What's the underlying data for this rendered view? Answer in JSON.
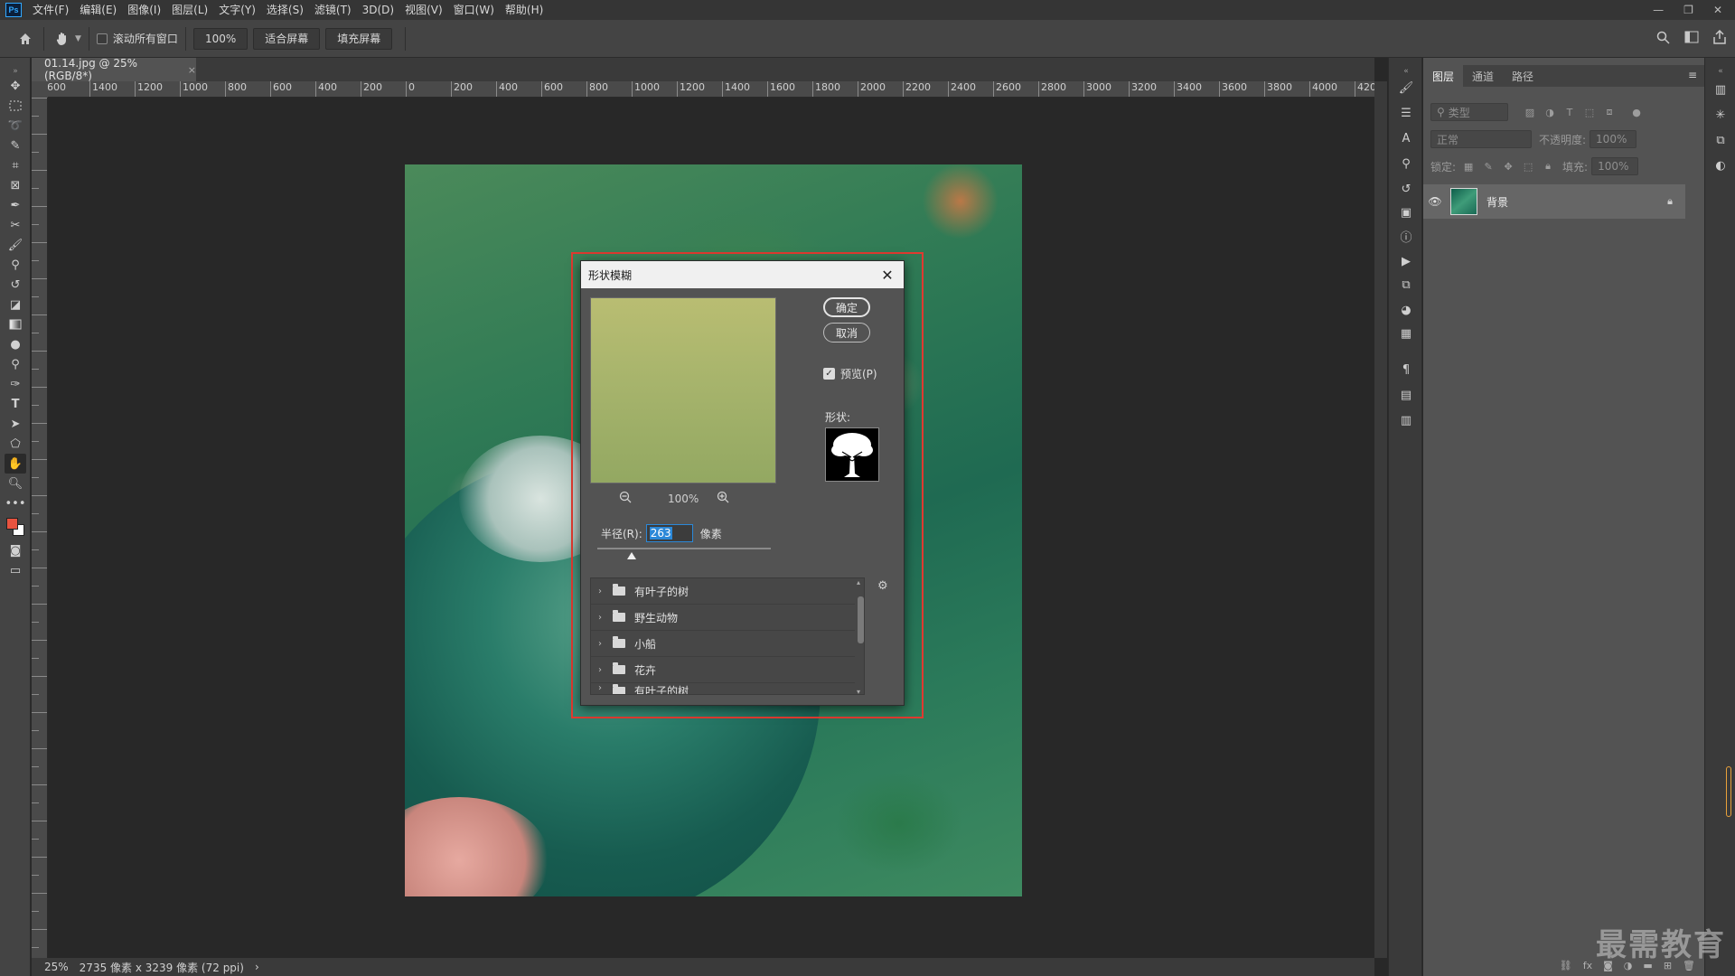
{
  "menubar": {
    "logo": "Ps",
    "items": [
      "文件(F)",
      "编辑(E)",
      "图像(I)",
      "图层(L)",
      "文字(Y)",
      "选择(S)",
      "滤镜(T)",
      "3D(D)",
      "视图(V)",
      "窗口(W)",
      "帮助(H)"
    ],
    "controls": [
      "—",
      "❐",
      "✕"
    ]
  },
  "options": {
    "scroll_all_label": "滚动所有窗口",
    "zoom_value": "100%",
    "fit_screen": "适合屏幕",
    "fill_screen": "填充屏幕"
  },
  "document": {
    "tab_title": "01.14.jpg @ 25%(RGB/8*)",
    "tab_close": "×"
  },
  "ruler_top_labels": [
    "600",
    "1400",
    "1200",
    "1000",
    "800",
    "600",
    "400",
    "200",
    "0",
    "200",
    "400",
    "600",
    "800",
    "1000",
    "1200",
    "1400",
    "1600",
    "1800",
    "2000",
    "2200",
    "2400",
    "2600",
    "2800",
    "3000",
    "3200",
    "3400",
    "3600",
    "3800",
    "4000",
    "420"
  ],
  "dialog": {
    "title": "形状模糊",
    "close": "✕",
    "ok": "确定",
    "cancel": "取消",
    "preview_label": "预览(P)",
    "preview_checked": true,
    "shape_label": "形状:",
    "zoom_percent": "100%",
    "radius_label": "半径(R):",
    "radius_value": "263",
    "radius_unit": "像素",
    "slider_fraction": 0.2,
    "shape_groups": [
      "有叶子的树",
      "野生动物",
      "小船",
      "花卉",
      "有叶子的树"
    ]
  },
  "status": {
    "zoom": "25%",
    "doc_info": "2735 像素 x 3239 像素 (72 ppi)",
    "arrow": "›"
  },
  "layers_panel": {
    "tabs": [
      "图层",
      "通道",
      "路径"
    ],
    "active_tab": "图层",
    "filter_placeholder": "类型",
    "blend_mode": "正常",
    "opacity_label": "不透明度:",
    "opacity_value": "100%",
    "lock_label": "锁定:",
    "fill_label": "填充:",
    "fill_value": "100%",
    "layer_name": "背景"
  },
  "watermark": "最需教育",
  "colors": {
    "foreground": "#e8533f",
    "background": "#ffffff",
    "highlight": "#e03a30"
  }
}
